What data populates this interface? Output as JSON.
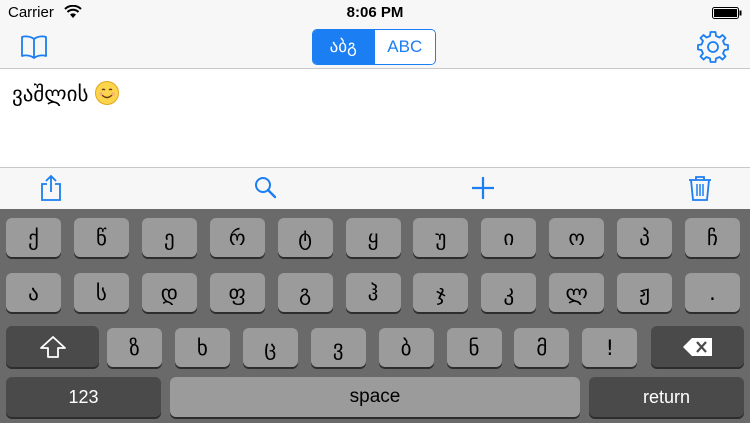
{
  "status_bar": {
    "carrier": "Carrier",
    "time": "8:06 PM"
  },
  "nav": {
    "book_icon": "book-icon",
    "segments": [
      {
        "label": "აბგ",
        "active": true
      },
      {
        "label": "ABC",
        "active": false
      }
    ],
    "gear_icon": "gear-icon",
    "accent": "#1b7ef2"
  },
  "editor": {
    "text": "ვაშლის",
    "emoji": "smiling-face"
  },
  "toolbar": {
    "items": [
      "share-icon",
      "search-icon",
      "plus-icon",
      "trash-icon"
    ]
  },
  "keyboard": {
    "row1": [
      "ქ",
      "წ",
      "ე",
      "რ",
      "ტ",
      "ყ",
      "უ",
      "ი",
      "ო",
      "პ",
      "ჩ"
    ],
    "row2": [
      "ა",
      "ს",
      "დ",
      "ფ",
      "გ",
      "ჰ",
      "ჯ",
      "კ",
      "ლ",
      "ჟ",
      "."
    ],
    "row3": [
      "ზ",
      "ხ",
      "ც",
      "ვ",
      "ბ",
      "ნ",
      "მ",
      "!"
    ],
    "numbers_label": "123",
    "space_label": "space",
    "return_label": "return",
    "shift_icon": "shift-icon",
    "delete_icon": "delete-icon"
  }
}
